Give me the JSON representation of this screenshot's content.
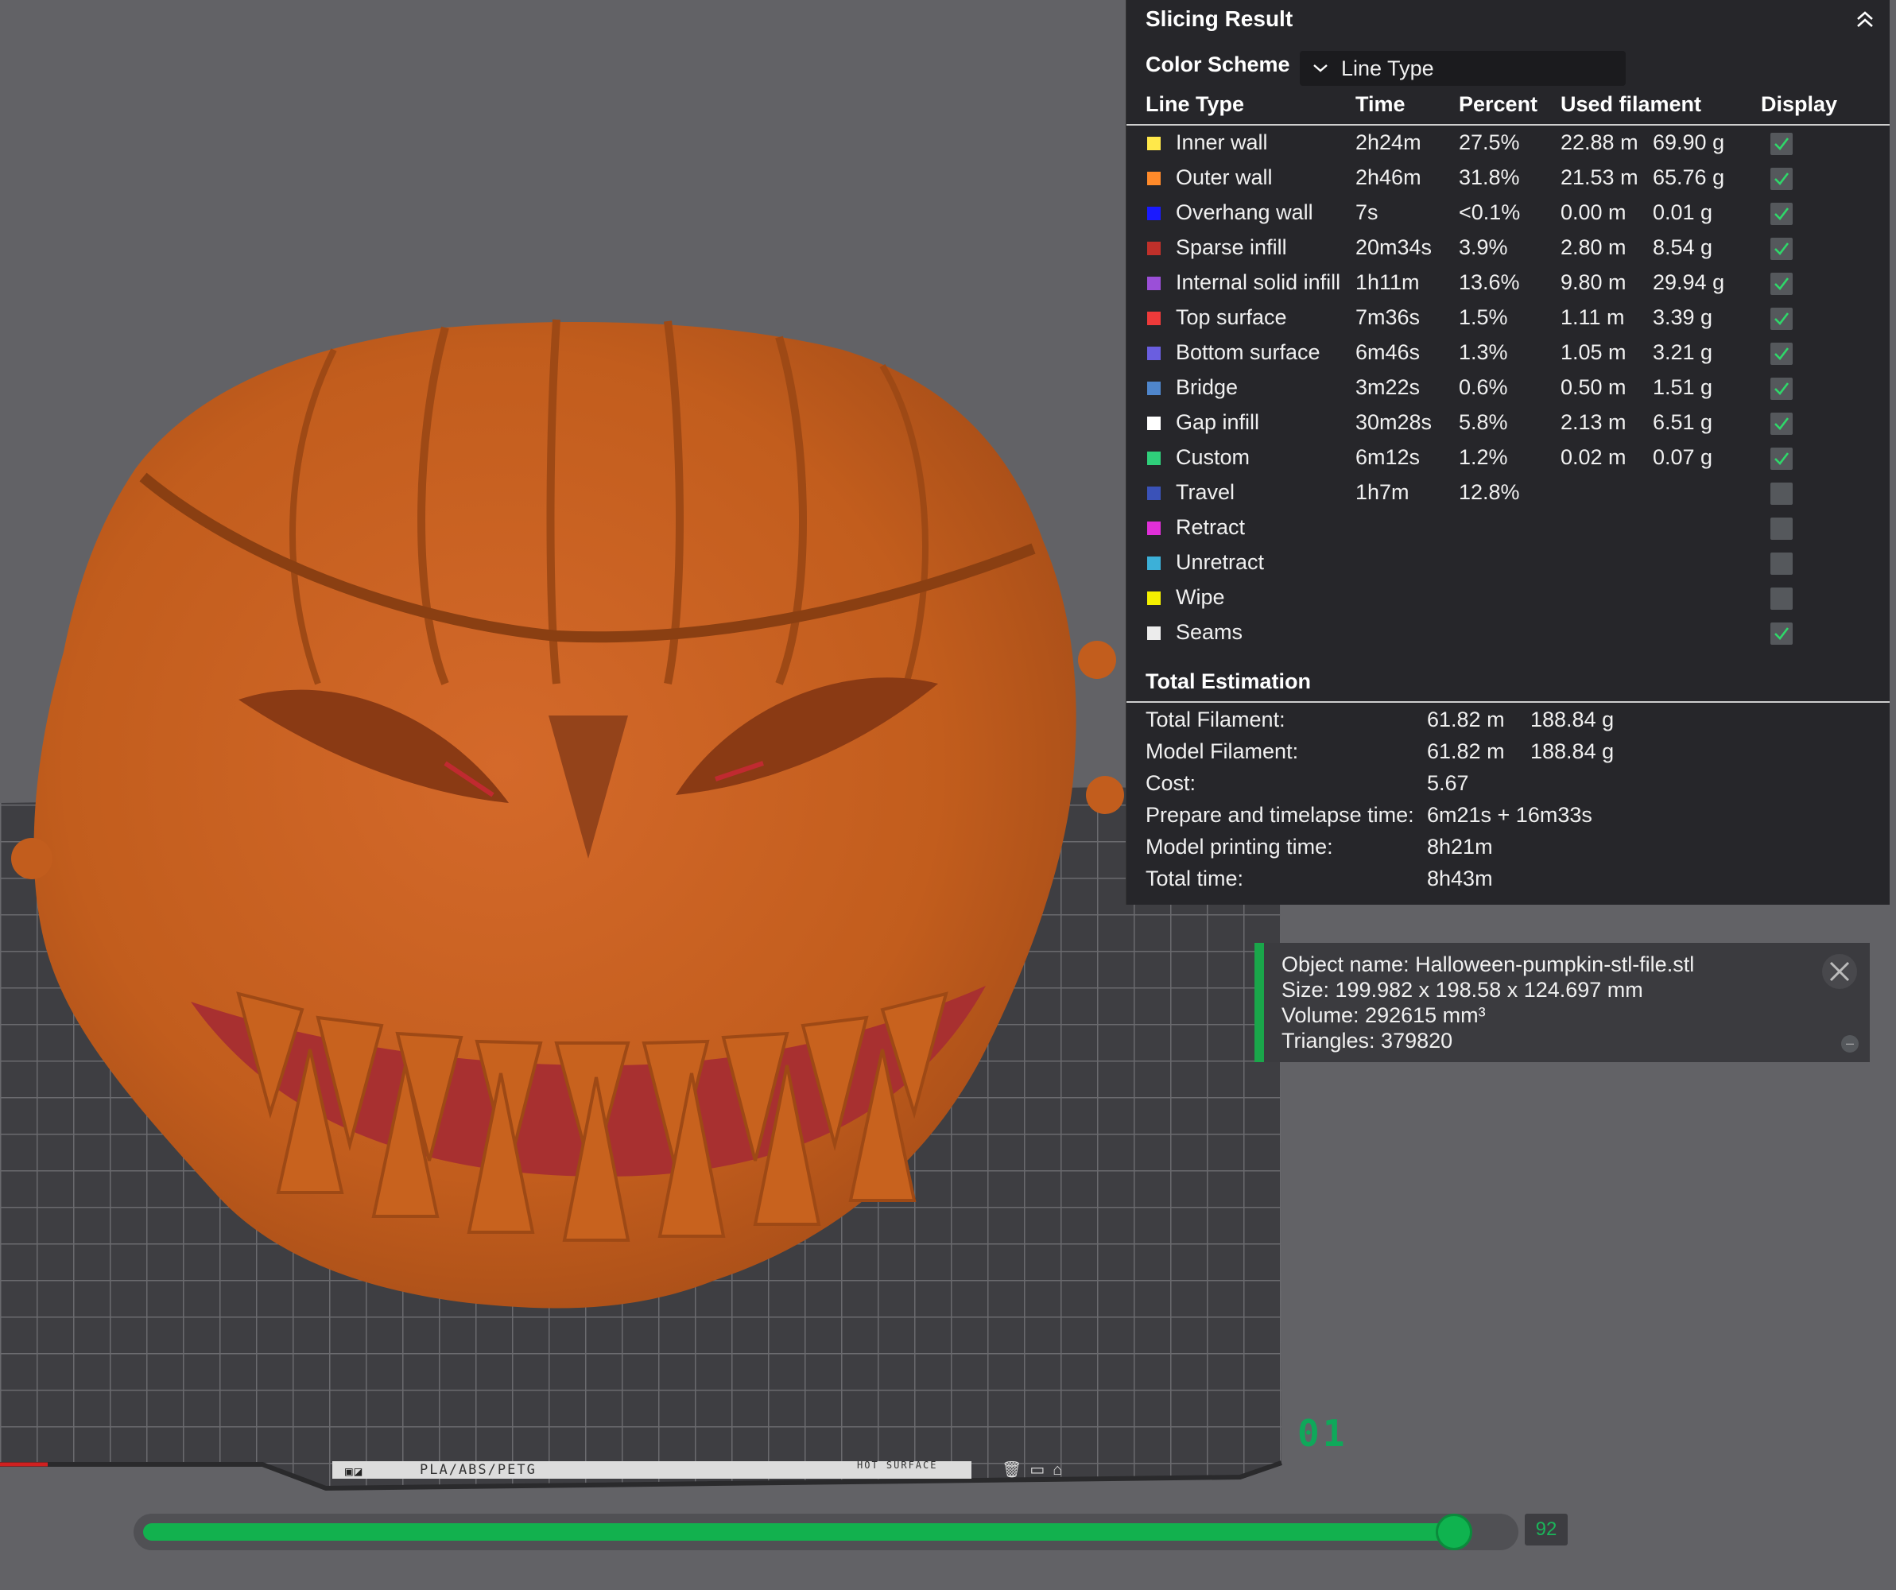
{
  "panel": {
    "title": "Slicing Result",
    "color_scheme_label": "Color Scheme",
    "color_scheme_value": "Line Type",
    "headers": {
      "line_type": "Line Type",
      "time": "Time",
      "percent": "Percent",
      "used_filament": "Used filament",
      "display": "Display"
    },
    "rows": [
      {
        "name": "Inner wall",
        "color": "#ffe84a",
        "time": "2h24m",
        "percent": "27.5%",
        "length": "22.88 m",
        "weight": "69.90 g",
        "display": true
      },
      {
        "name": "Outer wall",
        "color": "#ff8a2a",
        "time": "2h46m",
        "percent": "31.8%",
        "length": "21.53 m",
        "weight": "65.76 g",
        "display": true
      },
      {
        "name": "Overhang wall",
        "color": "#1a1aff",
        "time": "7s",
        "percent": "<0.1%",
        "length": "0.00 m",
        "weight": "0.01 g",
        "display": true
      },
      {
        "name": "Sparse infill",
        "color": "#c0302a",
        "time": "20m34s",
        "percent": "3.9%",
        "length": "2.80 m",
        "weight": "8.54 g",
        "display": true
      },
      {
        "name": "Internal solid infill",
        "color": "#9b4fd8",
        "time": "1h11m",
        "percent": "13.6%",
        "length": "9.80 m",
        "weight": "29.94 g",
        "display": true
      },
      {
        "name": "Top surface",
        "color": "#ee3a3a",
        "time": "7m36s",
        "percent": "1.5%",
        "length": "1.11 m",
        "weight": "3.39 g",
        "display": true
      },
      {
        "name": "Bottom surface",
        "color": "#6a5ee0",
        "time": "6m46s",
        "percent": "1.3%",
        "length": "1.05 m",
        "weight": "3.21 g",
        "display": true
      },
      {
        "name": "Bridge",
        "color": "#4f86cc",
        "time": "3m22s",
        "percent": "0.6%",
        "length": "0.50 m",
        "weight": "1.51 g",
        "display": true
      },
      {
        "name": "Gap infill",
        "color": "#ffffff",
        "time": "30m28s",
        "percent": "5.8%",
        "length": "2.13 m",
        "weight": "6.51 g",
        "display": true
      },
      {
        "name": "Custom",
        "color": "#2fcf7a",
        "time": "6m12s",
        "percent": "1.2%",
        "length": "0.02 m",
        "weight": "0.07 g",
        "display": true
      },
      {
        "name": "Travel",
        "color": "#3a52b8",
        "time": "1h7m",
        "percent": "12.8%",
        "length": "",
        "weight": "",
        "display": false
      },
      {
        "name": "Retract",
        "color": "#e02fd8",
        "time": "",
        "percent": "",
        "length": "",
        "weight": "",
        "display": false
      },
      {
        "name": "Unretract",
        "color": "#3cb0d8",
        "time": "",
        "percent": "",
        "length": "",
        "weight": "",
        "display": false
      },
      {
        "name": "Wipe",
        "color": "#f4f000",
        "time": "",
        "percent": "",
        "length": "",
        "weight": "",
        "display": false
      },
      {
        "name": "Seams",
        "color": "#ececec",
        "time": "",
        "percent": "",
        "length": "",
        "weight": "",
        "display": true
      }
    ],
    "total_title": "Total Estimation",
    "estimation": [
      {
        "label": "Total Filament:",
        "v1": "61.82 m",
        "v2": "188.84 g"
      },
      {
        "label": "Model Filament:",
        "v1": "61.82 m",
        "v2": "188.84 g"
      },
      {
        "label": "Cost:",
        "v1": "5.67",
        "v2": ""
      },
      {
        "label": "Prepare and timelapse time:",
        "v1": "6m21s + 16m33s",
        "v2": ""
      },
      {
        "label": "Model printing time:",
        "v1": "8h21m",
        "v2": ""
      },
      {
        "label": "Total time:",
        "v1": "8h43m",
        "v2": ""
      }
    ]
  },
  "object_info": {
    "name": "Object name: Halloween-pumpkin-stl-file.stl",
    "size": "Size: 199.982 x 198.58 x 124.697 mm",
    "volume": "Volume: 292615 mm³",
    "triangles": "Triangles: 379820"
  },
  "plate": {
    "number": "01",
    "filament_tag": "PLA/ABS/PETG",
    "surface_tag": "HOT SURFACE"
  },
  "layer_slider": {
    "value": "92",
    "fraction": 0.96
  },
  "colors": {
    "accent": "#12b14e",
    "model": "#c8621e",
    "panel_bg": "#26262a",
    "viewport_bg": "#626266"
  }
}
